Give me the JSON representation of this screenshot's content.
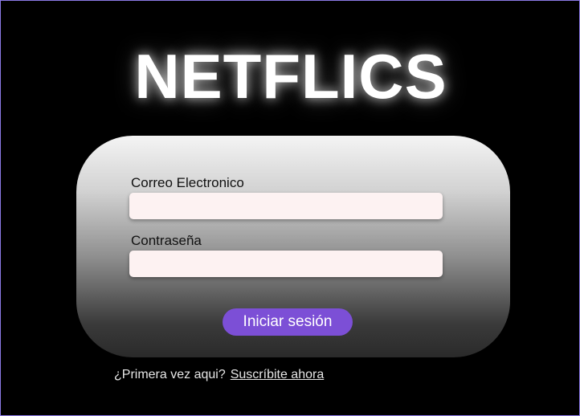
{
  "brand": {
    "title": "NETFLICS"
  },
  "login_form": {
    "email_label": "Correo Electronico",
    "email_value": "",
    "email_placeholder": "",
    "password_label": "Contraseña",
    "password_value": "",
    "password_placeholder": "",
    "submit_label": "Iniciar sesión"
  },
  "signup": {
    "prompt": "¿Primera vez aqui?",
    "link_label": "Suscríbite ahora"
  },
  "colors": {
    "background": "#000000",
    "accent_button": "#7c4fd6",
    "input_fill": "#fdf2f2",
    "frame_border": "#8c7ae6"
  }
}
